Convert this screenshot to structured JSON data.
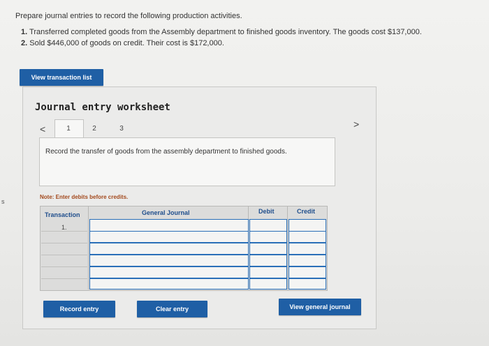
{
  "instructions": "Prepare journal entries to record the following production activities.",
  "steps": [
    {
      "num": "1.",
      "text": "Transferred completed goods from the Assembly department to finished goods inventory. The goods cost $137,000."
    },
    {
      "num": "2.",
      "text": "Sold $446,000 of goods on credit. Their cost is $172,000."
    }
  ],
  "margin_mark": "s",
  "view_transaction_list": "View transaction list",
  "worksheet": {
    "title": "Journal entry worksheet",
    "prev": "<",
    "next": ">",
    "tabs": [
      "1",
      "2",
      "3"
    ],
    "prompt": "Record the transfer of goods from the assembly department to finished goods.",
    "note": "Note: Enter debits before credits.",
    "columns": {
      "transaction": "Transaction",
      "general_journal": "General Journal",
      "debit": "Debit",
      "credit": "Credit"
    },
    "rows": [
      {
        "transaction": "1."
      },
      {
        "transaction": ""
      },
      {
        "transaction": ""
      },
      {
        "transaction": ""
      },
      {
        "transaction": ""
      },
      {
        "transaction": ""
      }
    ]
  },
  "buttons": {
    "record_entry": "Record entry",
    "clear_entry": "Clear entry",
    "view_general_journal": "View general journal"
  },
  "colors": {
    "button_blue": "#1f5fa5",
    "input_border": "#2a6fb8",
    "note_text": "#a34a1e"
  }
}
